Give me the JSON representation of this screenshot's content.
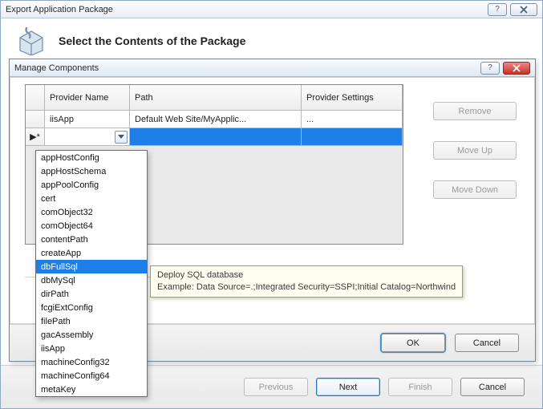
{
  "outer": {
    "title": "Export Application Package",
    "heading": "Select the Contents of the Package",
    "buttons": {
      "previous": "Previous",
      "next": "Next",
      "finish": "Finish",
      "cancel": "Cancel"
    }
  },
  "inner": {
    "title": "Manage Components",
    "columns": {
      "provider": "Provider Name",
      "path": "Path",
      "settings": "Provider Settings"
    },
    "rows": [
      {
        "provider": "iisApp",
        "path": "Default Web Site/MyApplic...",
        "settings": "..."
      }
    ],
    "newrow_marker": "▶*",
    "side_buttons": {
      "remove": "Remove",
      "moveup": "Move Up",
      "movedown": "Move Down"
    },
    "footer": {
      "ok": "OK",
      "cancel": "Cancel"
    }
  },
  "dropdown": {
    "items": [
      "appHostConfig",
      "appHostSchema",
      "appPoolConfig",
      "cert",
      "comObject32",
      "comObject64",
      "contentPath",
      "createApp",
      "dbFullSql",
      "dbMySql",
      "dirPath",
      "fcgiExtConfig",
      "filePath",
      "gacAssembly",
      "iisApp",
      "machineConfig32",
      "machineConfig64",
      "metaKey"
    ],
    "highlight_index": 8
  },
  "tooltip": {
    "line1": "Deploy SQL database",
    "line2": "Example: Data Source=.;Integrated Security=SSPI;Initial Catalog=Northwind"
  }
}
